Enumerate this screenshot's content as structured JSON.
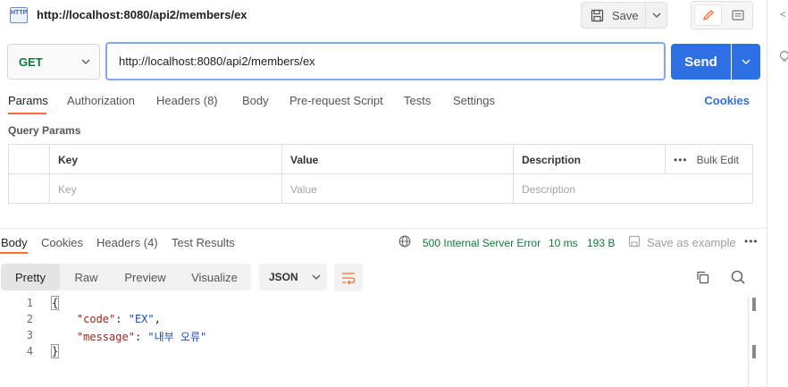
{
  "title_bar": {
    "http_badge": "HTTP",
    "title": "http://localhost:8080/api2/members/ex",
    "save_label": "Save",
    "icons": [
      "http-icon",
      "save-icon",
      "chevron-down-icon",
      "edit-icon",
      "comment-icon"
    ]
  },
  "request": {
    "method": "GET",
    "url": "http://localhost:8080/api2/members/ex",
    "send_label": "Send"
  },
  "request_tabs": [
    {
      "label": "Params"
    },
    {
      "label": "Authorization"
    },
    {
      "label": "Headers (8)"
    },
    {
      "label": "Body"
    },
    {
      "label": "Pre-request Script"
    },
    {
      "label": "Tests"
    },
    {
      "label": "Settings"
    }
  ],
  "cookies_label": "Cookies",
  "query_params": {
    "title": "Query Params",
    "headers": {
      "key": "Key",
      "value": "Value",
      "description": "Description",
      "bulk_edit": "Bulk Edit"
    },
    "placeholders": {
      "key": "Key",
      "value": "Value",
      "description": "Description"
    }
  },
  "response_tabs": [
    {
      "label": "Body"
    },
    {
      "label": "Cookies"
    },
    {
      "label": "Headers (4)"
    },
    {
      "label": "Test Results"
    }
  ],
  "response_meta": {
    "status": "500 Internal Server Error",
    "time": "10 ms",
    "size": "193 B",
    "save_example": "Save as example"
  },
  "format_tabs": [
    {
      "label": "Pretty"
    },
    {
      "label": "Raw"
    },
    {
      "label": "Preview"
    },
    {
      "label": "Visualize"
    }
  ],
  "format_select": "JSON",
  "response_body": {
    "line_numbers": [
      "1",
      "2",
      "3",
      "4"
    ],
    "open_brace": "{",
    "close_brace": "}",
    "code_key": "\"code\"",
    "code_value": "\"EX\"",
    "message_key": "\"message\"",
    "message_value": "\"내부 오류\""
  },
  "colors": {
    "accent": "#ff6c37",
    "primary": "#2f6fe4",
    "method_get": "#0f7b3a",
    "status_error": "#0f7b3a",
    "json_key": "#a1261b",
    "json_string": "#1848b6"
  }
}
